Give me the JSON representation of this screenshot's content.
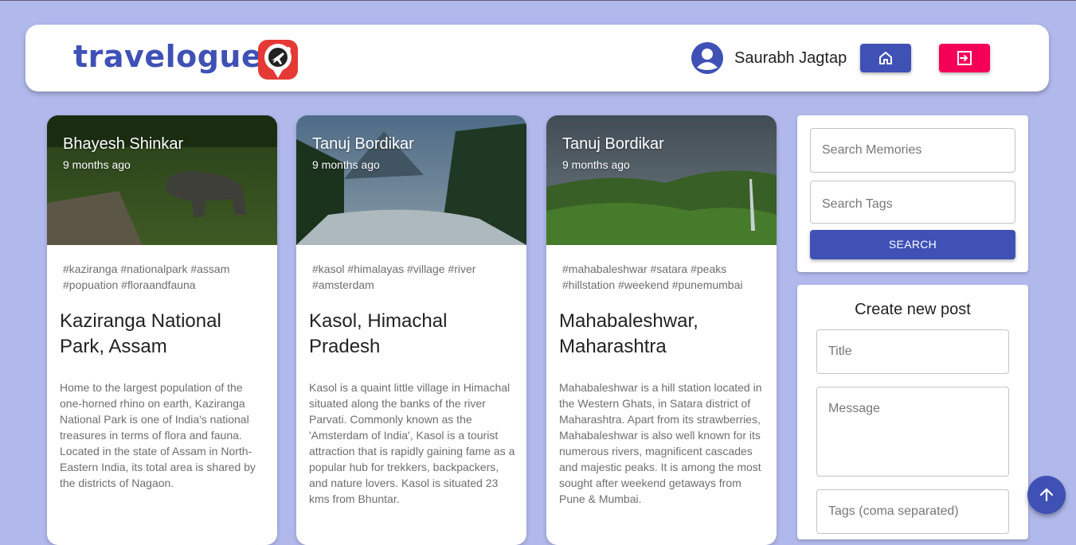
{
  "header": {
    "brand": "travelogue",
    "logo_icon": "travel-pin-logo-icon",
    "user_name": "Saurabh Jagtap",
    "home_icon": "home-icon",
    "logout_icon": "logout-icon",
    "colors": {
      "primary": "#3f51b5",
      "secondary": "#f50057",
      "logo": "#e53935"
    }
  },
  "posts": [
    {
      "author": "Bhayesh Shinkar",
      "time": "9 months ago",
      "tags": "#kaziranga #nationalpark #assam #popuation #floraandfauna",
      "title": "Kaziranga National Park, Assam",
      "message": "Home to the largest population of the one-horned rhino on earth, Kaziranga National Park is one of India's national treasures in terms of flora and fauna. Located in the state of Assam in North-Eastern India, its total area is shared by the districts of Nagaon."
    },
    {
      "author": "Tanuj Bordikar",
      "time": "9 months ago",
      "tags": "#kasol #himalayas #village #river #amsterdam",
      "title": "Kasol, Himachal Pradesh",
      "message": "Kasol is a quaint little village in Himachal situated along the banks of the river Parvati. Commonly known as the 'Amsterdam of India', Kasol is a tourist attraction that is rapidly gaining fame as a popular hub for trekkers, backpackers, and nature lovers. Kasol is situated 23 kms from Bhuntar."
    },
    {
      "author": "Tanuj Bordikar",
      "time": "9 months ago",
      "tags": "#mahabaleshwar #satara #peaks #hillstation #weekend #punemumbai",
      "title": "Mahabaleshwar, Maharashtra",
      "message": "Mahabaleshwar is a hill station located in the Western Ghats, in Satara district of Maharashtra. Apart from its strawberries, Mahabaleshwar is also well known for its numerous rivers, magnificent cascades and majestic peaks. It is among the most sought after weekend getaways from Pune & Mumbai."
    }
  ],
  "search": {
    "memories_placeholder": "Search Memories",
    "tags_placeholder": "Search Tags",
    "button": "SEARCH"
  },
  "form": {
    "heading": "Create new post",
    "title_placeholder": "Title",
    "message_placeholder": "Message",
    "tags_placeholder": "Tags (coma separated)"
  },
  "scroll_top_icon": "arrow-up-icon"
}
